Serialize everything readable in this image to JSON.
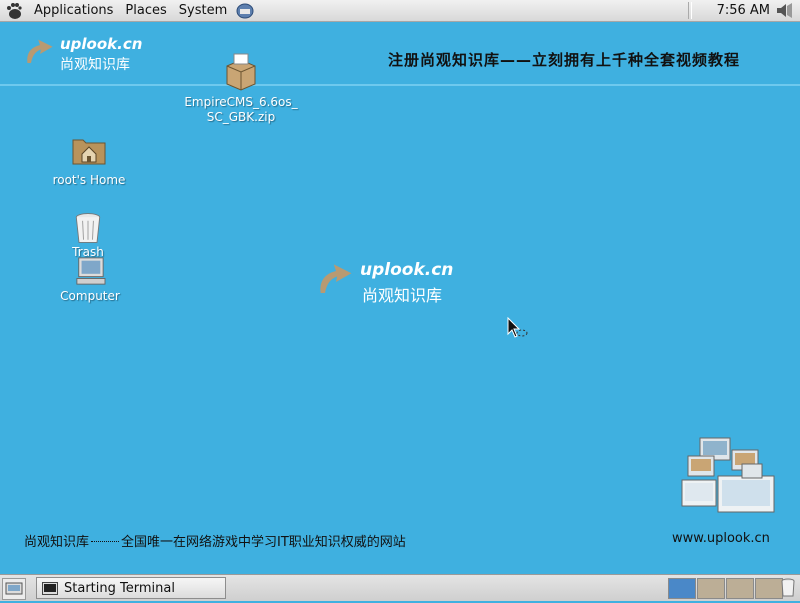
{
  "top_panel": {
    "menus": [
      "Applications",
      "Places",
      "System"
    ],
    "clock": "7:56 AM"
  },
  "banner": {
    "brand": "uplook.cn",
    "brand_cn": "尚观知识库",
    "slogan": "注册尚观知识库——立刻拥有上千种全套视频教程"
  },
  "center_logo": {
    "brand": "uplook.cn",
    "brand_cn": "尚观知识库"
  },
  "desktop_icons": {
    "zip_line1": "EmpireCMS_6.6os_",
    "zip_line2": "SC_GBK.zip",
    "home": "root's Home",
    "trash": "Trash",
    "computer": "Computer"
  },
  "footer": {
    "left_cn": "尚观知识库",
    "right_cn": "全国唯一在网络游戏中学习IT职业知识权威的网站",
    "website": "www.uplook.cn"
  },
  "taskbar": {
    "task_label": "Starting Terminal"
  },
  "colors": {
    "desktop_bg": "#3fb0e0",
    "logo_arc": "#b89a72"
  }
}
